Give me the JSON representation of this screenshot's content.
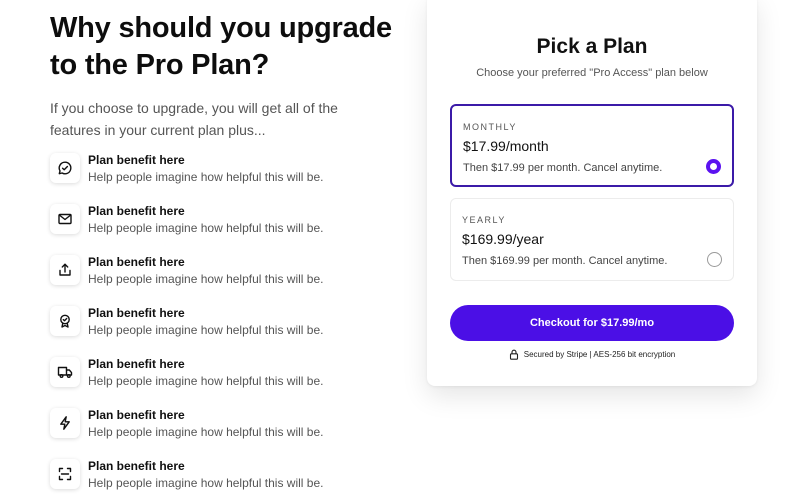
{
  "left": {
    "headline": "Why should you upgrade\nto the Pro Plan?",
    "intro": "If you choose to upgrade, you will get all of the\nfeatures in your current plan plus...",
    "benefits": [
      {
        "title": "Plan benefit here",
        "desc": "Help people imagine how helpful this will be.",
        "icon": "chat-bubble-check-icon"
      },
      {
        "title": "Plan benefit here",
        "desc": "Help people imagine how helpful this will be.",
        "icon": "mail-icon"
      },
      {
        "title": "Plan benefit here",
        "desc": "Help people imagine how helpful this will be.",
        "icon": "share-upload-icon"
      },
      {
        "title": "Plan benefit here",
        "desc": "Help people imagine how helpful this will be.",
        "icon": "badge-check-icon"
      },
      {
        "title": "Plan benefit here",
        "desc": "Help people imagine how helpful this will be.",
        "icon": "truck-icon"
      },
      {
        "title": "Plan benefit here",
        "desc": "Help people imagine how helpful this will be.",
        "icon": "lightning-icon"
      },
      {
        "title": "Plan benefit here",
        "desc": "Help people imagine how helpful this will be.",
        "icon": "scan-icon"
      }
    ]
  },
  "card": {
    "title": "Pick a Plan",
    "subtitle": "Choose your preferred \"Pro Access\" plan below",
    "options": [
      {
        "label": "MONTHLY",
        "price": "$17.99/month",
        "note": "Then $17.99 per month. Cancel anytime.",
        "selected": true
      },
      {
        "label": "YEARLY",
        "price": "$169.99/year",
        "note": "Then $169.99 per month. Cancel anytime.",
        "selected": false
      }
    ],
    "checkout_label": "Checkout for $17.99/mo",
    "secure_text": "Secured by Stripe | AES-256 bit encryption",
    "secure_icon": "lock-icon"
  },
  "colors": {
    "accent": "#4b0fe6",
    "selected_border": "#3b1aa8",
    "text": "#111111",
    "muted": "#555555"
  }
}
